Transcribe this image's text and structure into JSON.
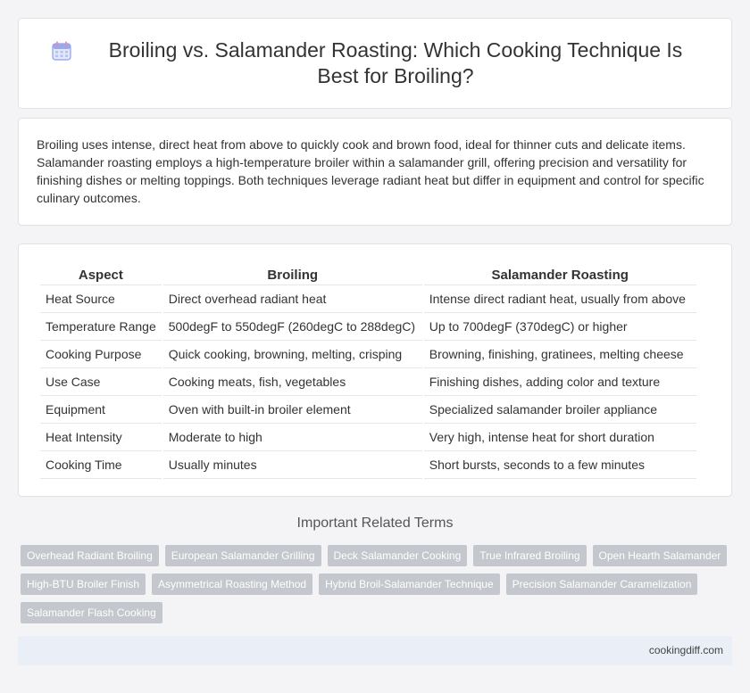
{
  "header": {
    "title": "Broiling vs. Salamander Roasting: Which Cooking Technique Is Best for Broiling?",
    "icon": "calendar-icon"
  },
  "intro": {
    "text": "Broiling uses intense, direct heat from above to quickly cook and brown food, ideal for thinner cuts and delicate items. Salamander roasting employs a high-temperature broiler within a salamander grill, offering precision and versatility for finishing dishes or melting toppings. Both techniques leverage radiant heat but differ in equipment and control for specific culinary outcomes."
  },
  "table": {
    "headers": [
      "Aspect",
      "Broiling",
      "Salamander Roasting"
    ],
    "rows": [
      [
        "Heat Source",
        "Direct overhead radiant heat",
        "Intense direct radiant heat, usually from above"
      ],
      [
        "Temperature Range",
        "500degF to 550degF (260degC to 288degC)",
        "Up to 700degF (370degC) or higher"
      ],
      [
        "Cooking Purpose",
        "Quick cooking, browning, melting, crisping",
        "Browning, finishing, gratinees, melting cheese"
      ],
      [
        "Use Case",
        "Cooking meats, fish, vegetables",
        "Finishing dishes, adding color and texture"
      ],
      [
        "Equipment",
        "Oven with built-in broiler element",
        "Specialized salamander broiler appliance"
      ],
      [
        "Heat Intensity",
        "Moderate to high",
        "Very high, intense heat for short duration"
      ],
      [
        "Cooking Time",
        "Usually minutes",
        "Short bursts, seconds to a few minutes"
      ]
    ]
  },
  "related": {
    "title": "Important Related Terms",
    "tags": [
      "Overhead Radiant Broiling",
      "European Salamander Grilling",
      "Deck Salamander Cooking",
      "True Infrared Broiling",
      "Open Hearth Salamander",
      "High-BTU Broiler Finish",
      "Asymmetrical Roasting Method",
      "Hybrid Broil-Salamander Technique",
      "Precision Salamander Caramelization",
      "Salamander Flash Cooking"
    ]
  },
  "footer": {
    "site": "cookingdiff.com"
  },
  "colors": {
    "tag_bg": "#c4c7cd",
    "footer_bg": "#e9eef7",
    "icon_accent": "#7b8de0"
  }
}
